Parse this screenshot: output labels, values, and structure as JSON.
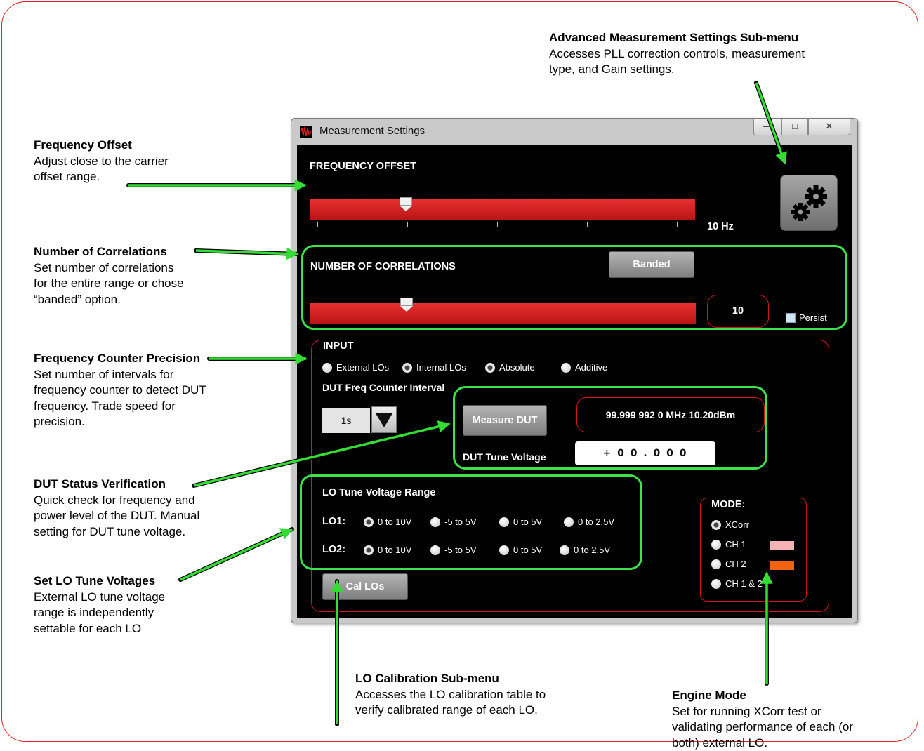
{
  "annotations": {
    "advanced": {
      "title": "Advanced Measurement Settings Sub-menu",
      "lines": [
        "Accesses PLL correction controls, measurement",
        "type, and Gain settings."
      ]
    },
    "frequency_offset": {
      "title": "Frequency Offset",
      "lines": [
        "Adjust close to the carrier",
        "offset range."
      ]
    },
    "num_correlations": {
      "title": "Number of Correlations",
      "lines": [
        "Set number of correlations",
        "for the entire range or chose",
        "“banded” option."
      ]
    },
    "freq_counter": {
      "title": "Frequency Counter Precision",
      "lines": [
        "Set number of intervals for",
        "frequency counter to detect DUT",
        "frequency. Trade speed for",
        "precision."
      ]
    },
    "dut_status": {
      "title": "DUT Status Verification",
      "lines": [
        "Quick check for frequency and",
        "power level of the DUT. Manual",
        "setting for DUT tune voltage."
      ]
    },
    "lo_tune": {
      "title": "Set LO Tune Voltages",
      "lines": [
        "External LO tune voltage",
        "range is independently",
        "settable for each LO"
      ]
    },
    "lo_cal": {
      "title": "LO Calibration Sub-menu",
      "lines": [
        "Accesses the LO calibration table to",
        "verify calibrated range of each LO."
      ]
    },
    "engine_mode": {
      "title": "Engine Mode",
      "lines": [
        "Set for running XCorr test or",
        "validating performance of each (or",
        "both) external LO."
      ]
    }
  },
  "window": {
    "title": "Measurement Settings",
    "controls": {
      "minimize": "—",
      "maximize": "□",
      "close": "✕"
    }
  },
  "frequency_offset": {
    "label": "FREQUENCY OFFSET",
    "value_text": "10 Hz",
    "slider_position": 0.25
  },
  "correlations": {
    "label": "NUMBER OF CORRELATIONS",
    "banded_label": "Banded",
    "value": "10",
    "slider_position": 0.25,
    "persist_label": "Persist",
    "persist_checked": false
  },
  "input": {
    "label": "INPUT",
    "options": [
      {
        "label": "External LOs",
        "selected": false
      },
      {
        "label": "Internal LOs",
        "selected": true
      },
      {
        "label": "Absolute",
        "selected": true
      },
      {
        "label": "Additive",
        "selected": false
      }
    ],
    "counter_label": "DUT Freq Counter Interval",
    "counter_value": "1s",
    "measure_dut_label": "Measure DUT",
    "dut_readout": "99.999 992 0 MHz 10.20dBm",
    "dut_tune_label": "DUT Tune Voltage",
    "dut_tune_value": "+ 0 0 . 0 0 0"
  },
  "lo_range": {
    "label": "LO Tune Voltage Range",
    "lo1_label": "LO1:",
    "lo2_label": "LO2:",
    "options": [
      "0 to 10V",
      "-5 to 5V",
      "0 to 5V",
      "0 to 2.5V"
    ],
    "lo1_selected": 0,
    "lo2_selected": 0
  },
  "cal_los_label": "Cal LOs",
  "mode": {
    "label": "MODE:",
    "options": [
      {
        "label": "XCorr",
        "selected": true,
        "swatch": ""
      },
      {
        "label": "CH 1",
        "selected": false,
        "swatch": "#f7b3b3"
      },
      {
        "label": "CH 2",
        "selected": false,
        "swatch": "#f26411"
      },
      {
        "label": "CH 1 & 2",
        "selected": false,
        "swatch": ""
      }
    ]
  },
  "colors": {
    "accent_green": "#39e34a",
    "outline_red": "#d01818",
    "slider_red": "#d62222"
  },
  "icons": [
    "gear-icon",
    "app-waveform-icon",
    "dropdown-arrow-icon"
  ]
}
